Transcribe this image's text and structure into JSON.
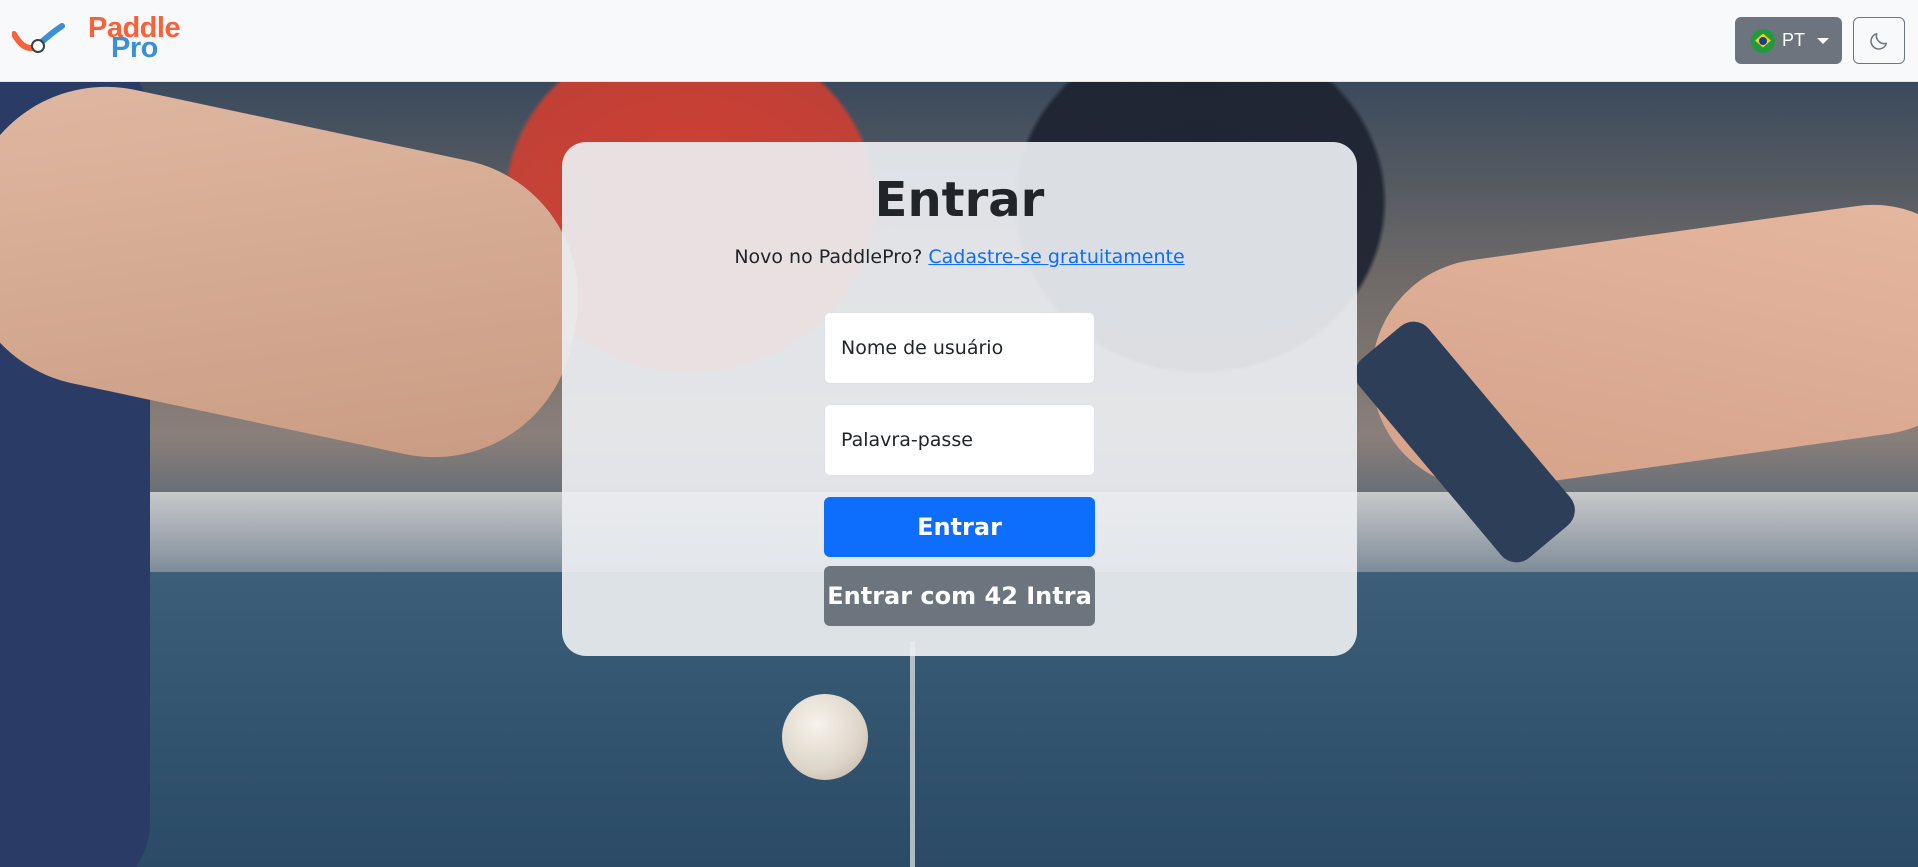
{
  "brand": {
    "name_part1": "Paddle",
    "name_part2": "Pro",
    "colors": {
      "paddle": "#f4633a",
      "pro": "#3b8fd4"
    }
  },
  "navbar": {
    "language": {
      "code": "PT",
      "flag_icon": "brazil-flag-icon",
      "caret_icon": "caret-down-icon"
    },
    "theme_toggle": {
      "icon": "moon-icon"
    }
  },
  "login": {
    "title": "Entrar",
    "signup_prompt": "Novo no PaddlePro?",
    "signup_link": "Cadastre-se gratuitamente",
    "username": {
      "placeholder": "Nome de usuário",
      "value": ""
    },
    "password": {
      "placeholder": "Palavra-passe",
      "value": ""
    },
    "submit_label": "Entrar",
    "intra_label": "Entrar com 42 Intra"
  },
  "colors": {
    "primary": "#0d6efd",
    "secondary": "#6c757d",
    "navbar_bg": "#f8f9fa",
    "text": "#212529"
  }
}
